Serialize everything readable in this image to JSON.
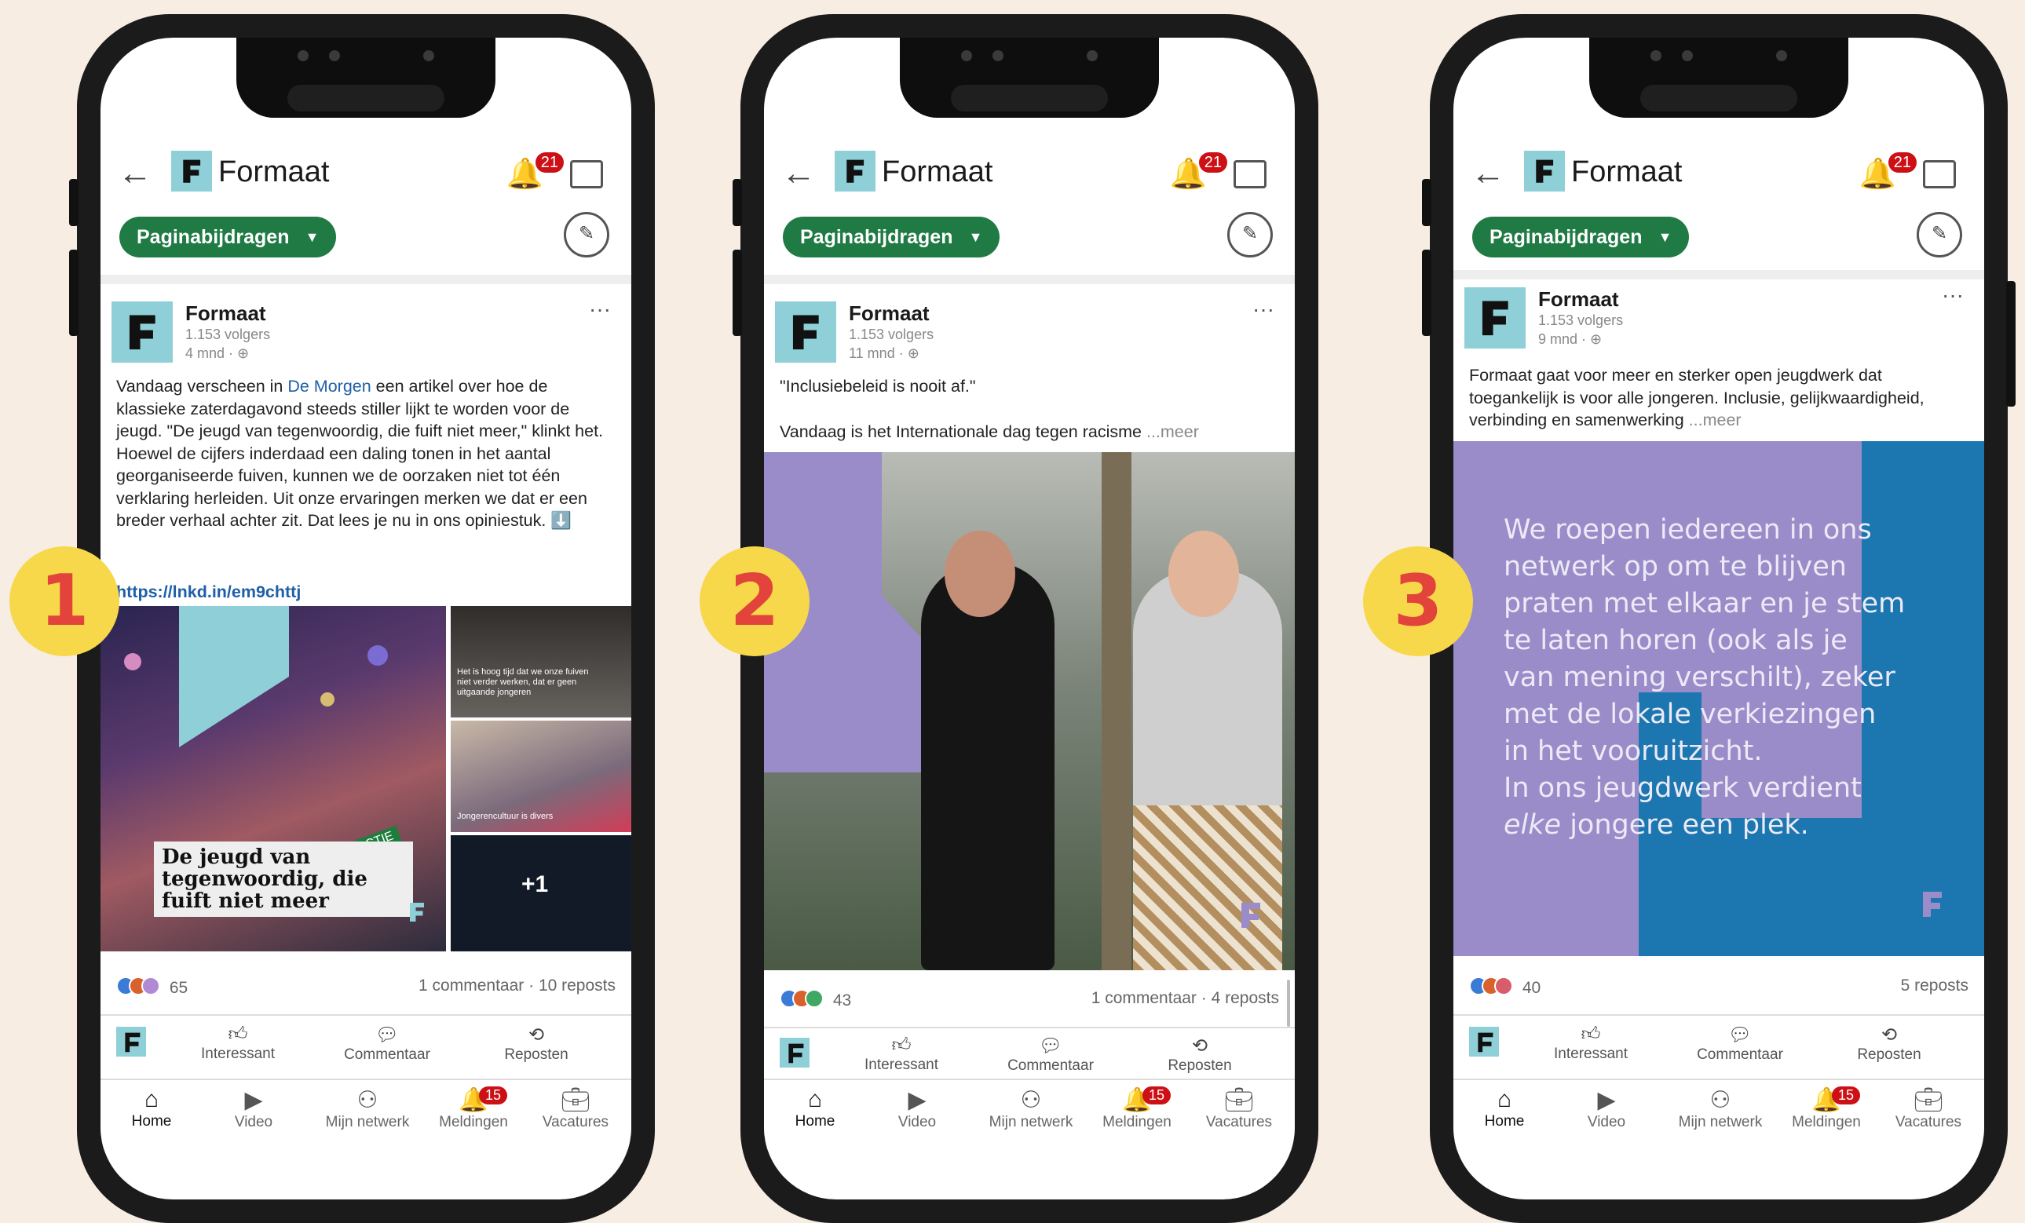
{
  "colors": {
    "background": "#f7ede3",
    "accent": "#1f7a44",
    "badge": "#cc1016",
    "brand": "#8fd0d8",
    "purple": "#9a8cc8",
    "blue": "#1c77b0",
    "marker": "#f7d84a",
    "marker_text": "#e2443c"
  },
  "phones": [
    {
      "number": "1",
      "header": {
        "title": "Formaat",
        "bell_count": "21",
        "pill": "Paginabijdragen"
      },
      "post": {
        "author": "Formaat",
        "followers": "1.153 volgers",
        "time": "4 mnd · ",
        "text_pre": "Vandaag verscheen in ",
        "text_link": "De Morgen",
        "text_post": " een artikel over hoe de klassieke zaterdagavond steeds stiller lijkt te worden voor de jeugd. \"De jeugd van tegenwoordig, die fuift niet meer,\" klinkt het. Hoewel de cijfers inderdaad een daling tonen in het aantal georganiseerde fuiven, kunnen we de oorzaken niet tot één verklaring herleiden. Uit onze ervaringen merken we dat er een breder verhaal achter zit. Dat lees je nu in ons opiniestuk. ⬇️",
        "url": "https://lnkd.in/em9chttj",
        "image_tag": "ONZE REACTIE",
        "image_headline": "De jeugd van tegenwoordig, die fuift niet meer",
        "side_caption1": "Het is hoog tijd dat we onze fuiven niet verder werken, dat er geen uitgaande jongeren",
        "side_caption2": "Jongerencultuur is divers",
        "side_count": "+1",
        "reactions": "65",
        "comments": "1 commentaar",
        "reposts": "10 reposts"
      }
    },
    {
      "number": "2",
      "header": {
        "title": "Formaat",
        "bell_count": "21",
        "pill": "Paginabijdragen"
      },
      "post": {
        "author": "Formaat",
        "followers": "1.153 volgers",
        "time": "11 mnd · ",
        "quote": "\"Inclusiebeleid is nooit af.\"",
        "text": "Vandaag is het Internationale dag tegen racisme",
        "more": "...meer",
        "reactions": "43",
        "comments": "1 commentaar",
        "reposts": "4 reposts"
      }
    },
    {
      "number": "3",
      "header": {
        "title": "Formaat",
        "bell_count": "21",
        "pill": "Paginabijdragen"
      },
      "post": {
        "author": "Formaat",
        "followers": "1.153 volgers",
        "time": "9 mnd · ",
        "text": "Formaat gaat voor meer en sterker open jeugdwerk dat toegankelijk is voor alle jongeren. Inclusie, gelijkwaardigheid, verbinding en samenwerking",
        "more": "...meer",
        "image_text_lines": [
          "We roepen iedereen in ons",
          "netwerk op om te blijven",
          "praten met elkaar en je stem",
          "te laten horen (ook als je",
          "van mening verschilt), zeker",
          "met de lokale verkiezingen",
          "in het vooruitzicht.",
          "In ons jeugdwerk verdient"
        ],
        "image_text_em": "elke",
        "image_text_last": " jongere een plek.",
        "reactions": "40",
        "reposts": "5 reposts"
      }
    }
  ],
  "actions": {
    "like": "Interessant",
    "comment": "Commentaar",
    "repost": "Reposten"
  },
  "tabs": {
    "home": "Home",
    "video": "Video",
    "network": "Mijn netwerk",
    "notifications": "Meldingen",
    "notifications_count": "15",
    "jobs": "Vacatures"
  }
}
